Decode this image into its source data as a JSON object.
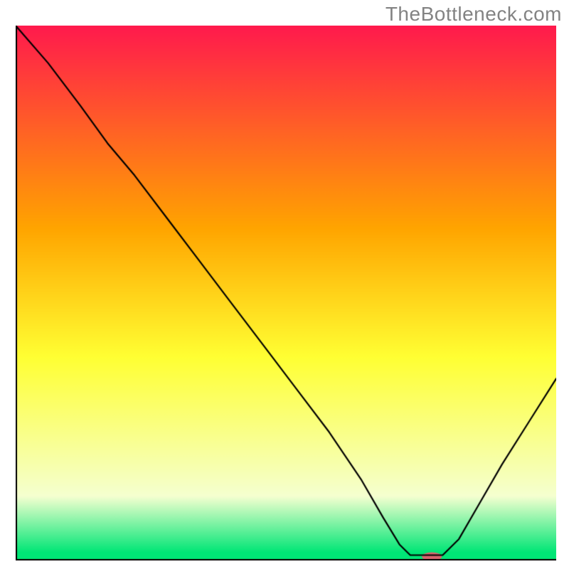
{
  "watermark": "TheBottleneck.com",
  "chart_data": {
    "type": "line",
    "title": "",
    "xlabel": "",
    "ylabel": "",
    "xlim": [
      0,
      100
    ],
    "ylim": [
      0,
      100
    ],
    "grid": false,
    "legend": false,
    "gradient_colors": {
      "top": "#ff1a4d",
      "mid1": "#ffa500",
      "mid2": "#ffff33",
      "mid3": "#f5ffd0",
      "bottom": "#00e676"
    },
    "curve": [
      {
        "x": 0,
        "y": 100
      },
      {
        "x": 6,
        "y": 93
      },
      {
        "x": 12,
        "y": 85
      },
      {
        "x": 17,
        "y": 78
      },
      {
        "x": 22,
        "y": 72
      },
      {
        "x": 28,
        "y": 64
      },
      {
        "x": 34,
        "y": 56
      },
      {
        "x": 40,
        "y": 48
      },
      {
        "x": 46,
        "y": 40
      },
      {
        "x": 52,
        "y": 32
      },
      {
        "x": 58,
        "y": 24
      },
      {
        "x": 64,
        "y": 15
      },
      {
        "x": 68,
        "y": 8
      },
      {
        "x": 71,
        "y": 3
      },
      {
        "x": 73,
        "y": 1
      },
      {
        "x": 76,
        "y": 1
      },
      {
        "x": 79,
        "y": 1
      },
      {
        "x": 82,
        "y": 4
      },
      {
        "x": 86,
        "y": 11
      },
      {
        "x": 90,
        "y": 18
      },
      {
        "x": 95,
        "y": 26
      },
      {
        "x": 100,
        "y": 34
      }
    ],
    "marker": {
      "x": 77,
      "y": 1,
      "color": "#d9646e",
      "rx": 14,
      "ry": 6
    }
  }
}
